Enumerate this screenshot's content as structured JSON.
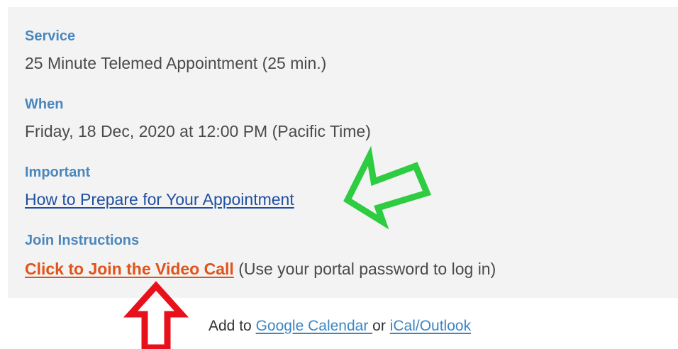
{
  "service": {
    "label": "Service",
    "value": "25 Minute Telemed Appointment (25 min.)"
  },
  "when": {
    "label": "When",
    "value": "Friday, 18 Dec, 2020 at 12:00 PM (Pacific Time)"
  },
  "important": {
    "label": "Important",
    "link_text": "How to Prepare for Your Appointment"
  },
  "join": {
    "label": "Join Instructions",
    "link_text": "Click to Join the Video Call",
    "note": " (Use your portal password to log in)"
  },
  "footer": {
    "prefix": "Add to ",
    "google_link": "Google Calendar ",
    "or_text": "or ",
    "ical_link": "iCal/Outlook"
  },
  "colors": {
    "label": "#4a87bd",
    "value_text": "#4a4a4a",
    "prepare_link": "#1f4f9e",
    "join_link": "#e0531a",
    "calendar_link": "#3c86c4",
    "green_arrow": "#2ecc40",
    "red_arrow": "#e8101a",
    "panel_bg": "#f3f3f3"
  },
  "icons": {
    "annotation_arrow_left": "green-arrow-icon",
    "annotation_arrow_up": "red-arrow-icon"
  }
}
